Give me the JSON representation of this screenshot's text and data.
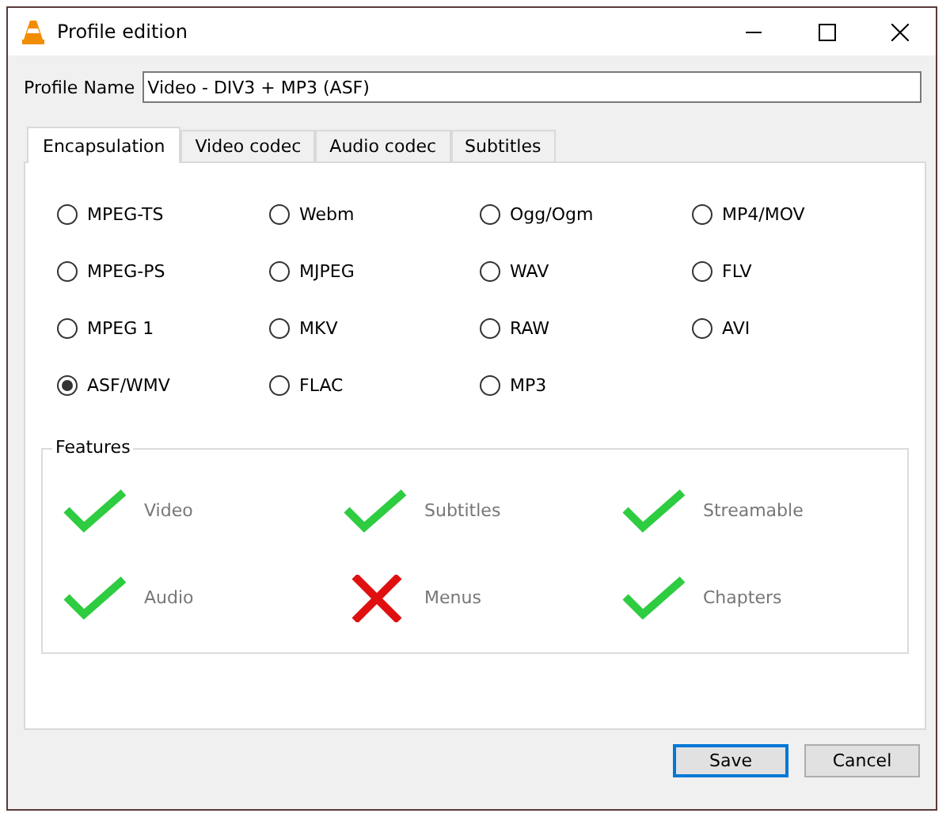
{
  "window": {
    "title": "Profile edition"
  },
  "profile_name": {
    "label": "Profile Name",
    "value": "Video - DIV3 + MP3 (ASF)"
  },
  "tabs": [
    {
      "label": "Encapsulation",
      "selected": true
    },
    {
      "label": "Video codec",
      "selected": false
    },
    {
      "label": "Audio codec",
      "selected": false
    },
    {
      "label": "Subtitles",
      "selected": false
    }
  ],
  "encapsulation": [
    {
      "label": "MPEG-TS",
      "selected": false
    },
    {
      "label": "Webm",
      "selected": false
    },
    {
      "label": "Ogg/Ogm",
      "selected": false
    },
    {
      "label": "MP4/MOV",
      "selected": false
    },
    {
      "label": "MPEG-PS",
      "selected": false
    },
    {
      "label": "MJPEG",
      "selected": false
    },
    {
      "label": "WAV",
      "selected": false
    },
    {
      "label": "FLV",
      "selected": false
    },
    {
      "label": "MPEG 1",
      "selected": false
    },
    {
      "label": "MKV",
      "selected": false
    },
    {
      "label": "RAW",
      "selected": false
    },
    {
      "label": "AVI",
      "selected": false
    },
    {
      "label": "ASF/WMV",
      "selected": true
    },
    {
      "label": "FLAC",
      "selected": false
    },
    {
      "label": "MP3",
      "selected": false
    }
  ],
  "features": {
    "title": "Features",
    "items": [
      {
        "label": "Video",
        "supported": true
      },
      {
        "label": "Subtitles",
        "supported": true
      },
      {
        "label": "Streamable",
        "supported": true
      },
      {
        "label": "Audio",
        "supported": true
      },
      {
        "label": "Menus",
        "supported": false
      },
      {
        "label": "Chapters",
        "supported": true
      }
    ]
  },
  "buttons": [
    {
      "label": "Save",
      "default": true
    },
    {
      "label": "Cancel",
      "default": false
    }
  ]
}
